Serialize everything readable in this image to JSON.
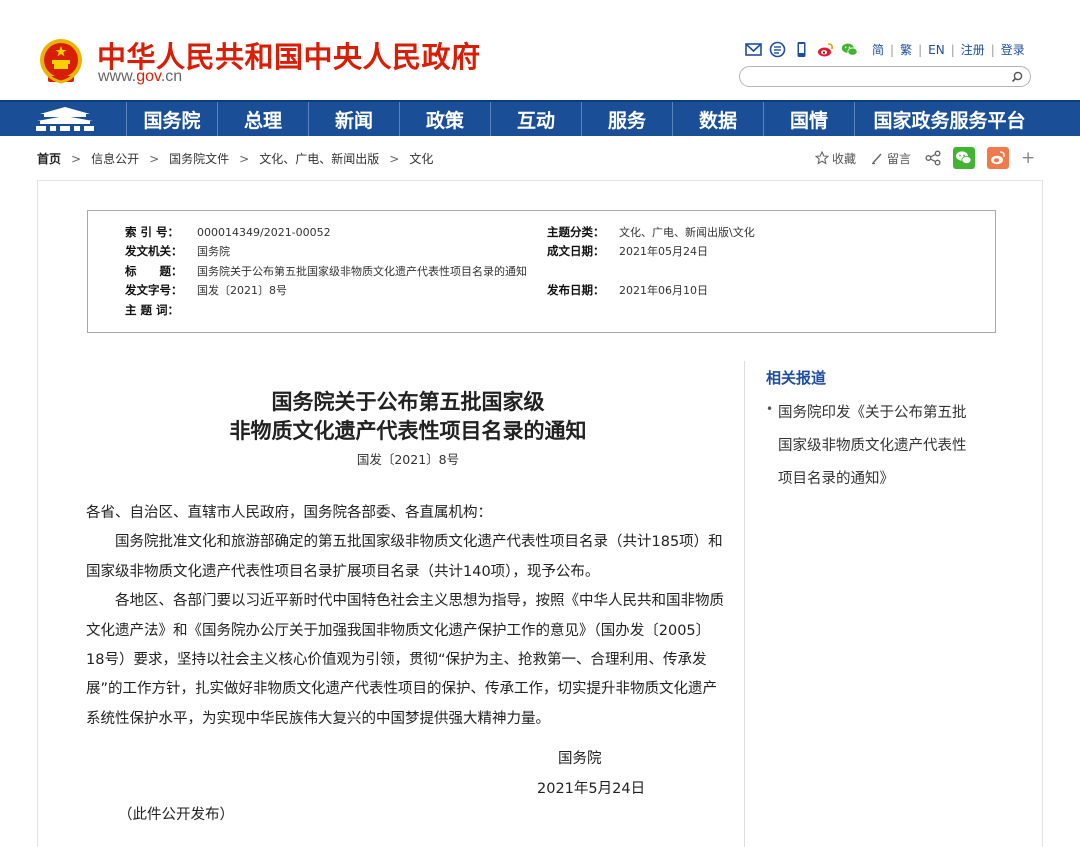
{
  "header": {
    "site_title": "中华人民共和国中央人民政府",
    "site_url_prefix": "www.",
    "site_url_domain": "gov",
    "site_url_suffix": ".cn",
    "tool_icons": [
      "mail-icon",
      "rss-icon",
      "mobile-icon",
      "weibo-icon",
      "wechat-icon"
    ],
    "links": [
      "简",
      "繁",
      "EN",
      "注册",
      "登录"
    ],
    "link_sep": "|",
    "search_placeholder": ""
  },
  "nav": {
    "items": [
      {
        "label": "国务院",
        "width": 91
      },
      {
        "label": "总理",
        "width": 91
      },
      {
        "label": "新闻",
        "width": 91
      },
      {
        "label": "政策",
        "width": 91
      },
      {
        "label": "互动",
        "width": 91
      },
      {
        "label": "服务",
        "width": 91
      },
      {
        "label": "数据",
        "width": 91
      },
      {
        "label": "国情",
        "width": 91
      },
      {
        "label": "国家政务服务平台",
        "width": 190
      }
    ]
  },
  "breadcrumb": {
    "home": "首页",
    "arrow": ">",
    "items": [
      "信息公开",
      "国务院文件",
      "文化、广电、新闻出版",
      "文化"
    ]
  },
  "share": {
    "favorite": "收藏",
    "comment": "留言",
    "plus": "+"
  },
  "info": {
    "index_label": "索 引 号：",
    "index_value": "000014349/2021-00052",
    "topic_label": "主题分类：",
    "topic_value": "文化、广电、新闻出版\\文化",
    "issuer_label": "发文机关：",
    "issuer_value": "国务院",
    "created_label": "成文日期：",
    "created_value": "2021年05月24日",
    "title_label": "标　　题：",
    "title_value": "国务院关于公布第五批国家级非物质文化遗产代表性项目名录的通知",
    "docno_label": "发文字号：",
    "docno_value": "国发〔2021〕8号",
    "published_label": "发布日期：",
    "published_value": "2021年06月10日",
    "keywords_label": "主 题 词：",
    "keywords_value": ""
  },
  "article": {
    "title_line1": "国务院关于公布第五批国家级",
    "title_line2": "非物质文化遗产代表性项目名录的通知",
    "doc_number": "国发〔2021〕8号",
    "salutation": "各省、自治区、直辖市人民政府，国务院各部委、各直属机构：",
    "para1": "国务院批准文化和旅游部确定的第五批国家级非物质文化遗产代表性项目名录（共计185项）和国家级非物质文化遗产代表性项目名录扩展项目名录（共计140项），现予公布。",
    "para2": "各地区、各部门要以习近平新时代中国特色社会主义思想为指导，按照《中华人民共和国非物质文化遗产法》和《国务院办公厅关于加强我国非物质文化遗产保护工作的意见》（国办发〔2005〕18号）要求，坚持以社会主义核心价值观为引领，贯彻“保护为主、抢救第一、合理利用、传承发展”的工作方针，扎实做好非物质文化遗产代表性项目的保护、传承工作，切实提升非物质文化遗产系统性保护水平，为实现中华民族伟大复兴的中国梦提供强大精神力量。",
    "sign_org": "国务院",
    "sign_date": "2021年5月24日",
    "public_note": "（此件公开发布）"
  },
  "sidebar": {
    "title": "相关报道",
    "items": [
      {
        "lines": [
          "国务院印发《关于公布第五批",
          "国家级非物质文化遗产代表性",
          "项目名录的通知》"
        ]
      }
    ]
  },
  "colors": {
    "brand_red": "#d81e06",
    "nav_blue": "#1a4f97",
    "link_blue": "#1f4e9c"
  }
}
